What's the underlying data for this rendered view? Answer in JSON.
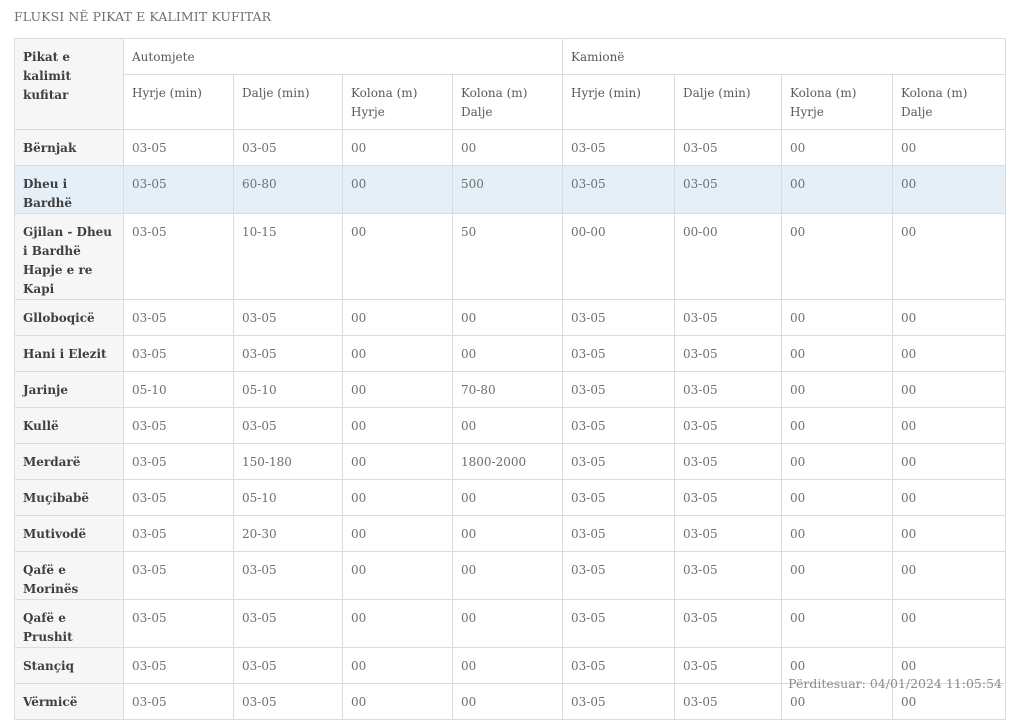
{
  "page": {
    "title": "FLUKSI NË PIKAT E KALIMIT KUFITAR",
    "updated": "Përditesuar: 04/01/2024 11:05:54"
  },
  "table": {
    "corner_header": "Pikat e kalimit kufitar",
    "group_headers": [
      "Automjete",
      "Kamionë"
    ],
    "sub_headers": [
      "Hyrje (min)",
      "Dalje (min)",
      "Kolona (m) Hyrje",
      "Kolona (m) Dalje",
      "Hyrje (min)",
      "Dalje (min)",
      "Kolona (m) Hyrje",
      "Kolona (m) Dalje"
    ],
    "highlight_color": "#e5eff7",
    "rows": [
      {
        "name": [
          "Bërnjak"
        ],
        "values": [
          "03-05",
          "03-05",
          "00",
          "00",
          "03-05",
          "03-05",
          "00",
          "00"
        ]
      },
      {
        "name": [
          "Dheu i Bardhë"
        ],
        "values": [
          "03-05",
          "60-80",
          "00",
          "500",
          "03-05",
          "03-05",
          "00",
          "00"
        ],
        "highlighted": true
      },
      {
        "name": [
          "Gjilan - Dheu i Bardhë",
          "Hapje e re Kapi"
        ],
        "values": [
          "03-05",
          "10-15",
          "00",
          "50",
          "00-00",
          "00-00",
          "00",
          "00"
        ]
      },
      {
        "name": [
          "Glloboqicë"
        ],
        "values": [
          "03-05",
          "03-05",
          "00",
          "00",
          "03-05",
          "03-05",
          "00",
          "00"
        ]
      },
      {
        "name": [
          "Hani i Elezit"
        ],
        "values": [
          "03-05",
          "03-05",
          "00",
          "00",
          "03-05",
          "03-05",
          "00",
          "00"
        ]
      },
      {
        "name": [
          "Jarinje"
        ],
        "values": [
          "05-10",
          "05-10",
          "00",
          "70-80",
          "03-05",
          "03-05",
          "00",
          "00"
        ]
      },
      {
        "name": [
          "Kullë"
        ],
        "values": [
          "03-05",
          "03-05",
          "00",
          "00",
          "03-05",
          "03-05",
          "00",
          "00"
        ]
      },
      {
        "name": [
          "Merdarë"
        ],
        "values": [
          "03-05",
          "150-180",
          "00",
          "1800-2000",
          "03-05",
          "03-05",
          "00",
          "00"
        ]
      },
      {
        "name": [
          "Muçibabë"
        ],
        "values": [
          "03-05",
          "05-10",
          "00",
          "00",
          "03-05",
          "03-05",
          "00",
          "00"
        ]
      },
      {
        "name": [
          "Mutivodë"
        ],
        "values": [
          "03-05",
          "20-30",
          "00",
          "00",
          "03-05",
          "03-05",
          "00",
          "00"
        ]
      },
      {
        "name": [
          "Qafë e Morinës"
        ],
        "values": [
          "03-05",
          "03-05",
          "00",
          "00",
          "03-05",
          "03-05",
          "00",
          "00"
        ]
      },
      {
        "name": [
          "Qafë e Prushit"
        ],
        "values": [
          "03-05",
          "03-05",
          "00",
          "00",
          "03-05",
          "03-05",
          "00",
          "00"
        ]
      },
      {
        "name": [
          "Stançiq"
        ],
        "values": [
          "03-05",
          "03-05",
          "00",
          "00",
          "03-05",
          "03-05",
          "00",
          "00"
        ]
      },
      {
        "name": [
          "Vërmicë"
        ],
        "values": [
          "03-05",
          "03-05",
          "00",
          "00",
          "03-05",
          "03-05",
          "00",
          "00"
        ]
      }
    ]
  }
}
